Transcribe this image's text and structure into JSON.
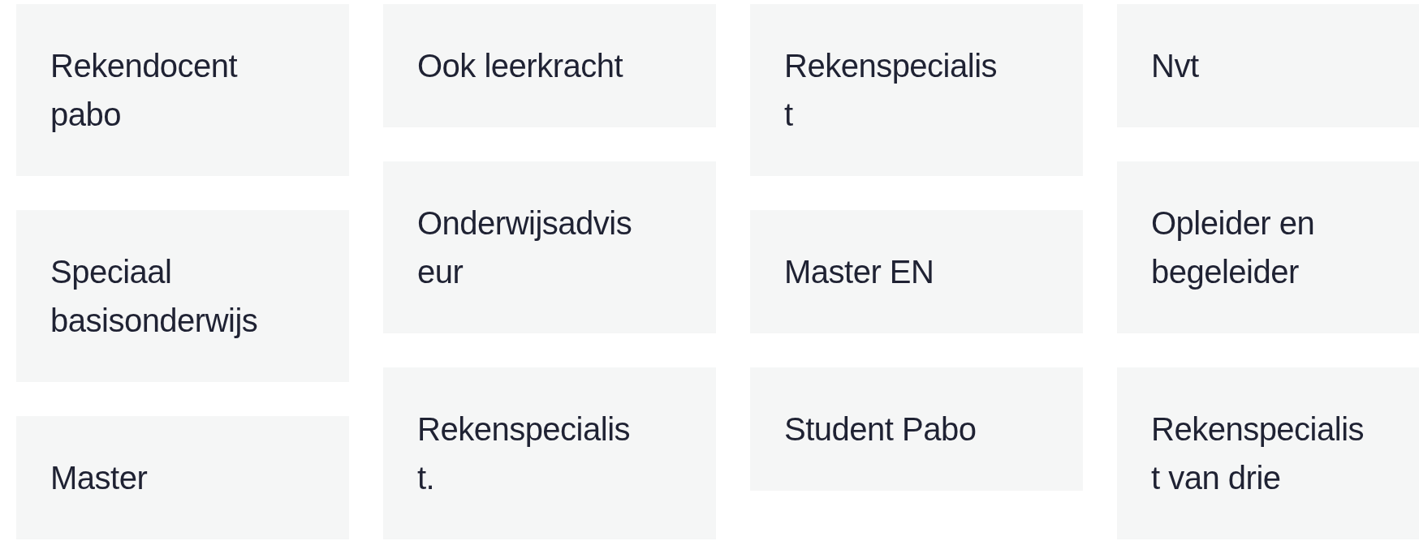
{
  "columns": [
    {
      "cards": [
        {
          "text": "Rekendocent pabo"
        },
        {
          "text": "Speciaal basisonderwijs"
        },
        {
          "text": "Master"
        }
      ]
    },
    {
      "cards": [
        {
          "text": "Ook leerkracht"
        },
        {
          "text": "Onderwijsadviseur"
        },
        {
          "text": "Rekenspecialist."
        }
      ]
    },
    {
      "cards": [
        {
          "text": "Rekenspecialist"
        },
        {
          "text": "Master EN"
        },
        {
          "text": "Student Pabo"
        }
      ]
    },
    {
      "cards": [
        {
          "text": "Nvt"
        },
        {
          "text": "Opleider en begeleider"
        },
        {
          "text": "Rekenspecialist van drie"
        }
      ]
    }
  ]
}
